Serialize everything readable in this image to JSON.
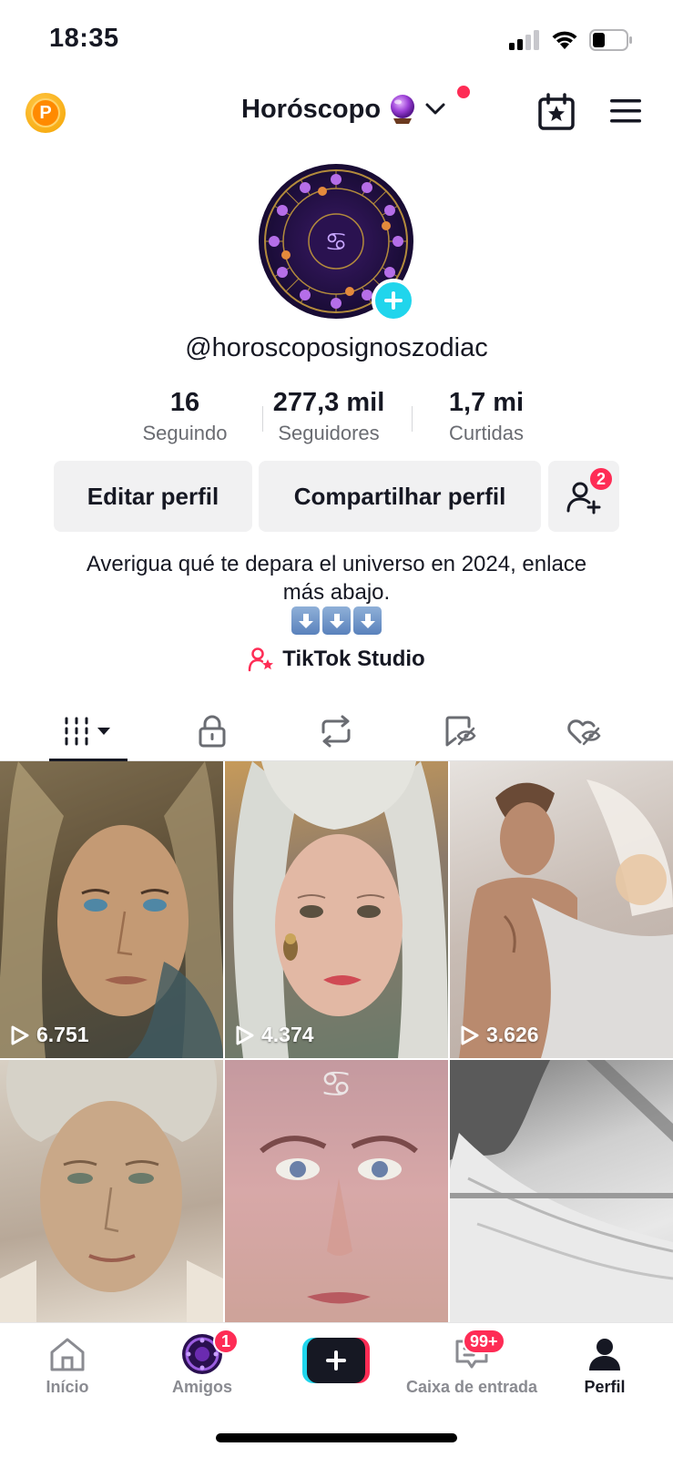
{
  "status_bar": {
    "time": "18:35"
  },
  "header": {
    "account_name": "Horóscopo",
    "coin_letter": "P",
    "icons": [
      "coin-icon",
      "crystal-ball-icon",
      "chevron-down-icon",
      "calendar-star-icon",
      "menu-icon"
    ]
  },
  "profile": {
    "username": "@horoscoposignoszodiac",
    "stats": [
      {
        "value": "16",
        "label": "Seguindo"
      },
      {
        "value": "277,3 mil",
        "label": "Seguidores"
      },
      {
        "value": "1,7 mi",
        "label": "Curtidas"
      }
    ],
    "edit_label": "Editar perfil",
    "share_label": "Compartilhar perfil",
    "friends_badge": "2",
    "bio_line1": "Averigua qué te depara el universo en 2024, enlace",
    "bio_line2": "más abajo.",
    "studio_label": "TikTok Studio"
  },
  "tabs": [
    "videos-tab",
    "private-tab",
    "reposts-tab",
    "favorites-tab",
    "liked-tab"
  ],
  "videos": [
    {
      "views": "6.751"
    },
    {
      "views": "4.374"
    },
    {
      "views": "3.626"
    },
    {
      "views": ""
    },
    {
      "views": ""
    },
    {
      "views": ""
    }
  ],
  "bottom_nav": {
    "home": "Início",
    "friends": "Amigos",
    "friends_badge": "1",
    "inbox": "Caixa de entrada",
    "inbox_badge": "99+",
    "profile": "Perfil"
  },
  "colors": {
    "accent": "#fe2c55",
    "cyan": "#20d5ec",
    "text": "#161823",
    "muted": "#8a8b91"
  }
}
